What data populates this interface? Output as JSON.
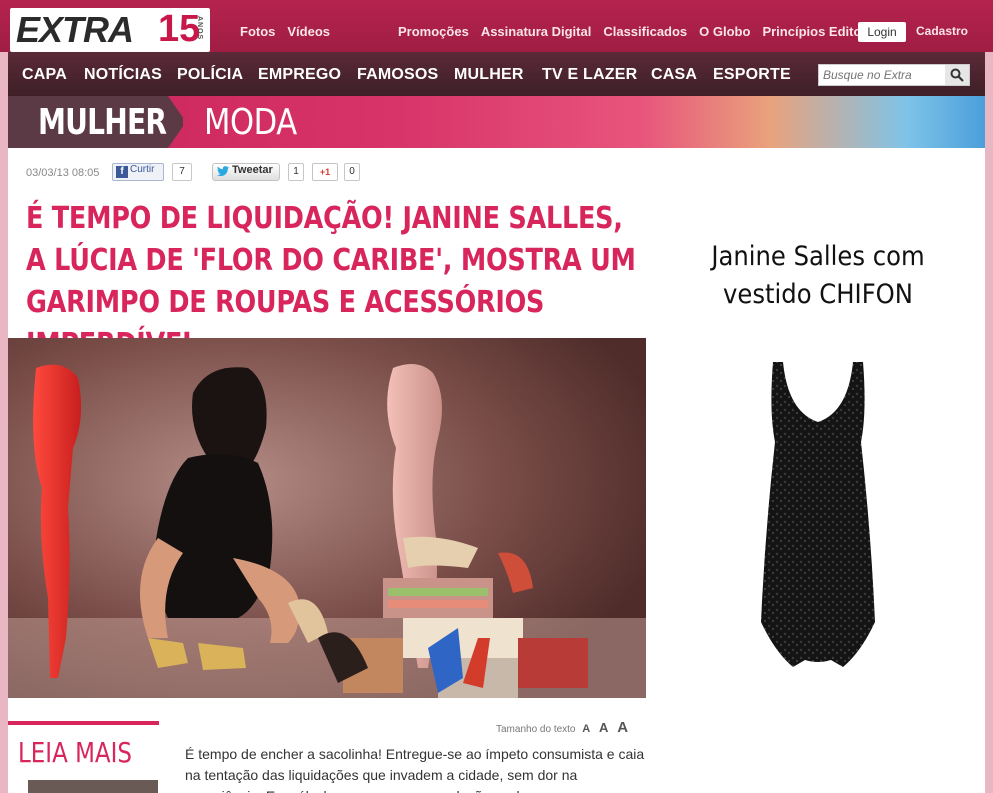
{
  "brand": {
    "logo": "EXTRA",
    "anniversary": "15",
    "anniversary_label": "ANOS"
  },
  "topbar": {
    "left_links": [
      "Fotos",
      "Vídeos"
    ],
    "right_links": [
      "Promoções",
      "Assinatura Digital",
      "Classificados",
      "O Globo",
      "Princípios Editoriais"
    ],
    "login": "Login",
    "signup": "Cadastro"
  },
  "nav": {
    "items": [
      "CAPA",
      "NOTÍCIAS",
      "POLÍCIA",
      "EMPREGO",
      "FAMOSOS",
      "MULHER",
      "TV E LAZER",
      "CASA",
      "ESPORTE"
    ],
    "search_placeholder": "Busque no Extra"
  },
  "section": {
    "parent": "MULHER",
    "child": "MODA"
  },
  "article": {
    "date": "03/03/13 08:05",
    "facebook_label": "Curtir",
    "facebook_count": "7",
    "twitter_label": "Tweetar",
    "twitter_count": "1",
    "gplus_label": "+1",
    "gplus_count": "0",
    "headline": "É tempo de liquidação! Janine Salles, a Lúcia de 'Flor do Caribe', mostra um garimpo de roupas e acessórios imperdível",
    "text_size_label": "Tamanho do texto",
    "text_size_options": [
      "A",
      "A",
      "A"
    ],
    "body": "É tempo de encher a sacolinha! Entregue-se ao ímpeto consumista e caia na tentação das liquidações que invadem a cidade, sem dor na consciência. Em cálculos, as peças com reduções pelo"
  },
  "ad": {
    "title_line1": "Janine Salles com",
    "title_line2": "vestido CHIFON"
  },
  "sidebar": {
    "read_more": "LEIA MAIS"
  },
  "colors": {
    "brand_red": "#c8184a",
    "headline_pink": "#d8255c",
    "nav_dark": "#3e1f28"
  }
}
